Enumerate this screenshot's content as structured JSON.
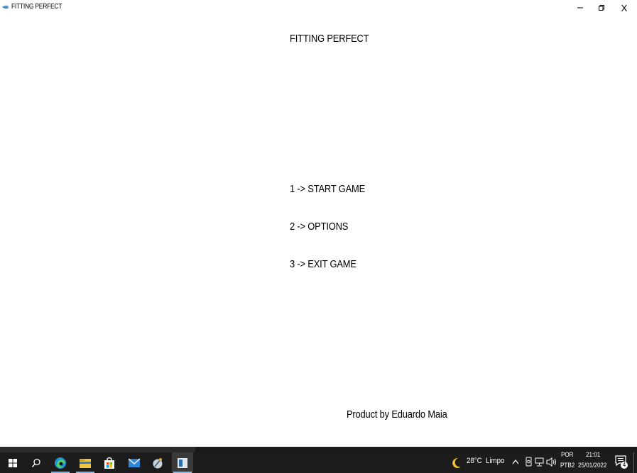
{
  "window": {
    "title": "FITTING PERFECT",
    "icon": "game-app-icon",
    "controls": [
      "minimize-icon",
      "restore-icon",
      "close-icon"
    ],
    "close_label": "X"
  },
  "game": {
    "title": "FITTING PERFECT",
    "menu": [
      {
        "label": "1 -> START GAME"
      },
      {
        "label": "2 -> OPTIONS"
      },
      {
        "label": "3 -> EXIT GAME"
      }
    ],
    "credit": "Product by Eduardo Maia"
  },
  "taskbar": {
    "background": "#1c1c1c",
    "accent": "#76b9ed",
    "apps": [
      "windows-start-icon",
      "search-icon",
      "edge-browser-icon",
      "file-explorer-icon",
      "microsoft-store-icon",
      "mail-icon",
      "app-icon",
      "game-window-icon"
    ],
    "weather": {
      "temp": "28°C",
      "condition": "Limpo",
      "icon": "moon-icon"
    },
    "language": {
      "top": "POR",
      "bottom": "PTB2"
    },
    "clock": {
      "time": "21:01",
      "date": "25/01/2022"
    },
    "notifications": {
      "count": "4"
    }
  }
}
